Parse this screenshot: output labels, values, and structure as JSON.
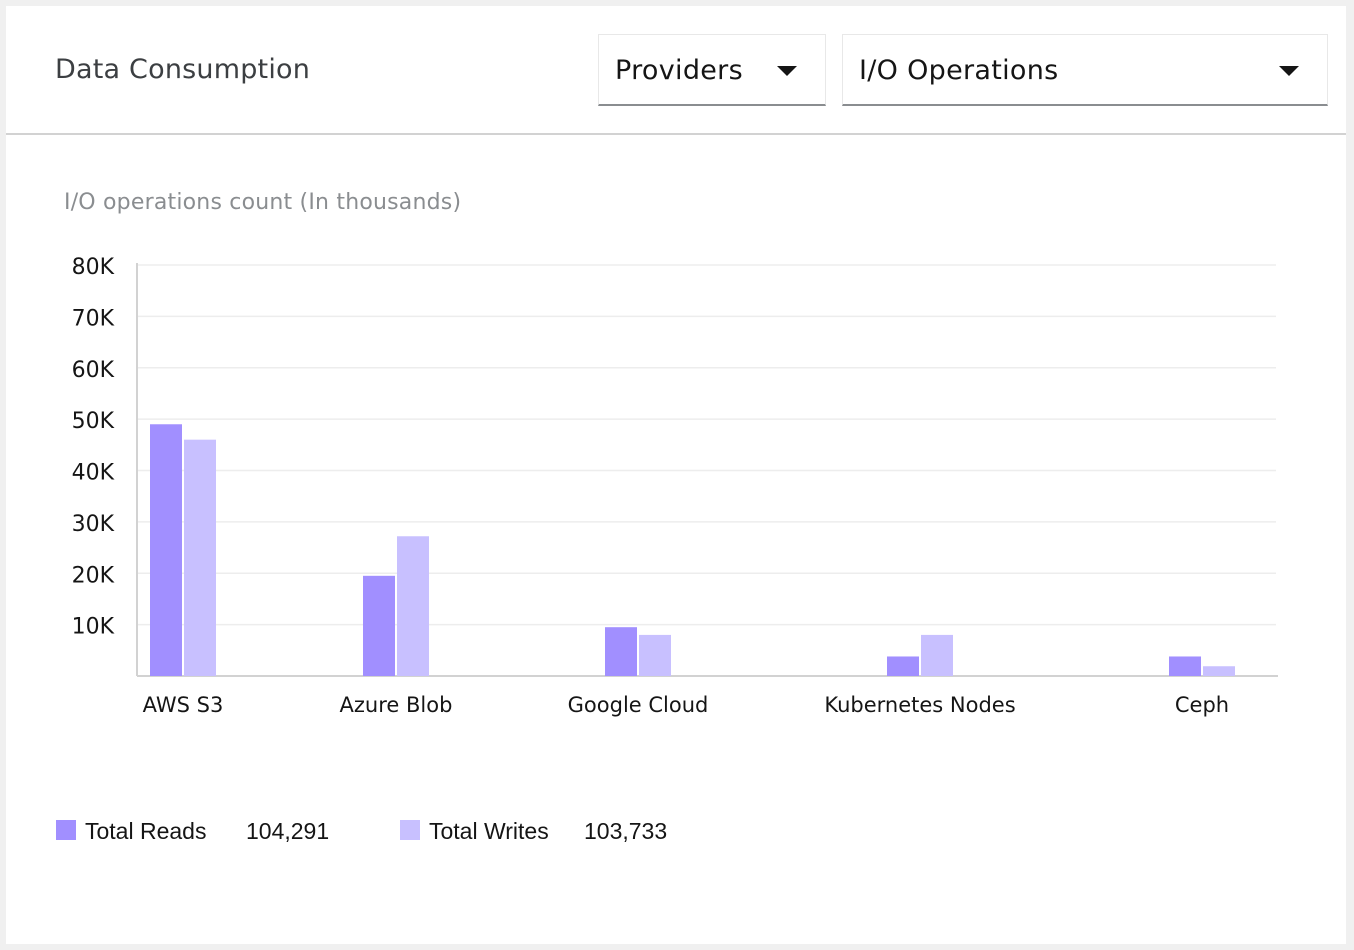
{
  "header": {
    "title": "Data Consumption",
    "provider_select": {
      "value": "Providers"
    },
    "metric_select": {
      "value": "I/O Operations"
    }
  },
  "colors": {
    "reads": "#a18fff",
    "writes": "#c8c0ff",
    "grid": "#ededed",
    "axis": "#d2d2d2"
  },
  "chart_data": {
    "type": "bar",
    "title": "I/O operations count (In thousands)",
    "xlabel": "",
    "ylabel": "",
    "categories": [
      "AWS S3",
      "Azure Blob",
      "Google Cloud",
      "Kubernetes Nodes",
      "Ceph"
    ],
    "series": [
      {
        "name": "Total Reads",
        "values": [
          49000,
          19500,
          9500,
          3800,
          3800
        ]
      },
      {
        "name": "Total Writes",
        "values": [
          46000,
          27200,
          8000,
          8000,
          1900
        ]
      }
    ],
    "yticks": [
      10000,
      20000,
      30000,
      40000,
      50000,
      60000,
      70000,
      80000
    ],
    "ytick_labels": [
      "10K",
      "20K",
      "30K",
      "40K",
      "50K",
      "60K",
      "70K",
      "80K"
    ],
    "ylim": [
      0,
      80000
    ],
    "grid": true,
    "legend_position": "bottom-left"
  },
  "legend": {
    "reads": {
      "label": "Total Reads",
      "total": "104,291"
    },
    "writes": {
      "label": "Total Writes",
      "total": "103,733"
    }
  }
}
